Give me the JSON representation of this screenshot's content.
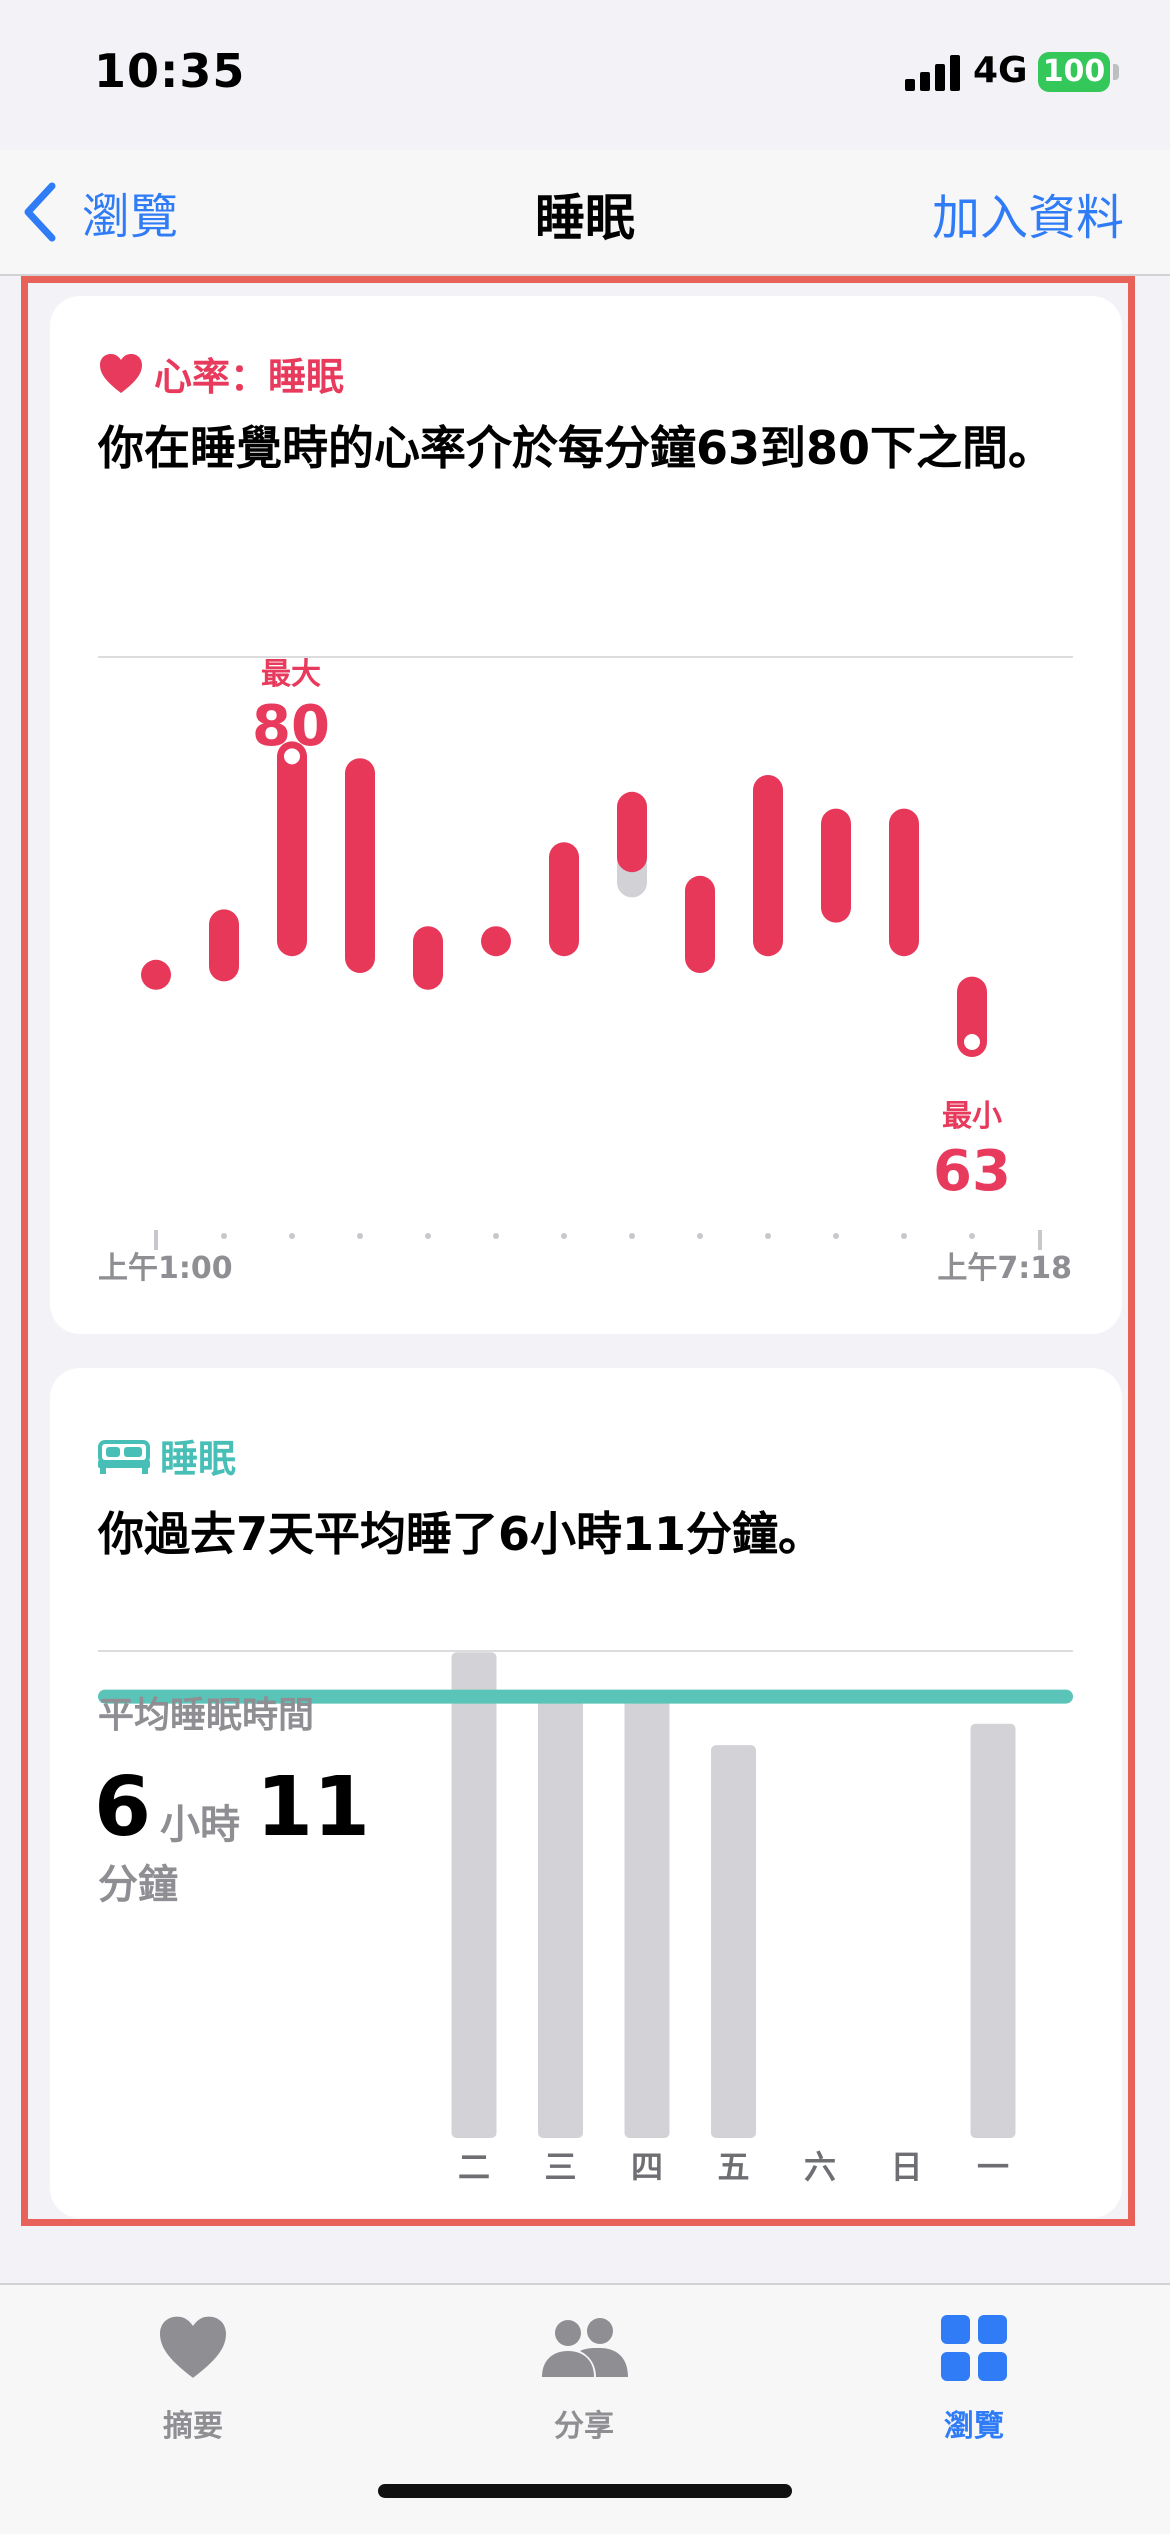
{
  "status_bar": {
    "time": "10:35",
    "network": "4G",
    "battery": "100"
  },
  "nav": {
    "back_label": "瀏覽",
    "title": "睡眠",
    "add_data_label": "加入資料"
  },
  "heart_rate_card": {
    "header": "心率：睡眠",
    "summary": "你在睡覺時的心率介於每分鐘63到80下之間。",
    "chart_data": {
      "type": "range-bar",
      "x_start_label": "上午1:00",
      "x_end_label": "上午7:18",
      "max_label": "最大",
      "max_value": "80",
      "min_label": "最小",
      "min_value": "63",
      "ranges": [
        {
          "low": 67,
          "high": 67
        },
        {
          "low": 67.5,
          "high": 70
        },
        {
          "low": 69,
          "high": 80
        },
        {
          "low": 68,
          "high": 79
        },
        {
          "low": 67,
          "high": 69
        },
        {
          "low": 69,
          "high": 69
        },
        {
          "low": 69,
          "high": 74
        },
        {
          "low": 74,
          "high": 77,
          "extra_low": 72.5
        },
        {
          "low": 68,
          "high": 72
        },
        {
          "low": 69,
          "high": 78
        },
        {
          "low": 71,
          "high": 76
        },
        {
          "low": 69,
          "high": 76
        },
        {
          "low": 63,
          "high": 66
        }
      ],
      "colors": {
        "bar": "#e8385a",
        "extra": "#d1d1d6"
      }
    }
  },
  "sleep_card": {
    "header": "睡眠",
    "summary": "你過去7天平均睡了6小時11分鐘。",
    "avg_label": "平均睡眠時間",
    "avg_hours": "6",
    "hours_unit": "小時",
    "avg_minutes": "11",
    "minutes_unit": "分鐘",
    "chart_data": {
      "type": "bar",
      "categories": [
        "二",
        "三",
        "四",
        "五",
        "六",
        "日",
        "一"
      ],
      "values": [
        6.8,
        6.2,
        6.25,
        5.5,
        0,
        0,
        5.8
      ],
      "average": 6.18,
      "ylim": [
        0,
        7
      ],
      "colors": {
        "bar": "#d3d3d7",
        "average_line": "#5bc4b9"
      }
    }
  },
  "tab_bar": {
    "tabs": [
      {
        "label": "摘要",
        "icon": "heart-icon"
      },
      {
        "label": "分享",
        "icon": "people-icon"
      },
      {
        "label": "瀏覽",
        "icon": "grid-icon"
      }
    ]
  }
}
